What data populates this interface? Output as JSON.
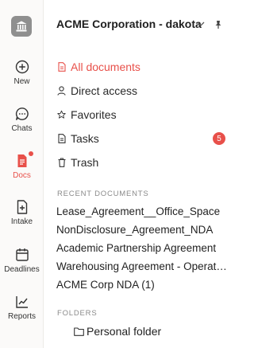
{
  "rail": {
    "items": [
      {
        "label": "New",
        "icon": "plus-circle-icon"
      },
      {
        "label": "Chats",
        "icon": "chat-bubble-icon"
      },
      {
        "label": "Docs",
        "icon": "document-icon",
        "active": true
      },
      {
        "label": "Intake",
        "icon": "document-plus-icon"
      },
      {
        "label": "Deadlines",
        "icon": "calendar-icon"
      },
      {
        "label": "Reports",
        "icon": "line-chart-icon"
      }
    ]
  },
  "header": {
    "org_name": "ACME Corporation - dakota"
  },
  "nav": {
    "all_documents": "All documents",
    "direct_access": "Direct access",
    "favorites": "Favorites",
    "tasks": "Tasks",
    "tasks_badge": "5",
    "trash": "Trash"
  },
  "recent": {
    "heading": "RECENT DOCUMENTS",
    "items": [
      "Lease_Agreement__Office_Space",
      "NonDisclosure_Agreement_NDA",
      "Academic Partnership Agreement",
      "Warehousing Agreement - Operations",
      "ACME Corp NDA (1)"
    ]
  },
  "folders": {
    "heading": "FOLDERS",
    "items": [
      "Personal folder"
    ]
  },
  "colors": {
    "accent": "#e8504a",
    "rail_bg": "#fbfaf9",
    "logo_bg": "#8f8f8f"
  }
}
